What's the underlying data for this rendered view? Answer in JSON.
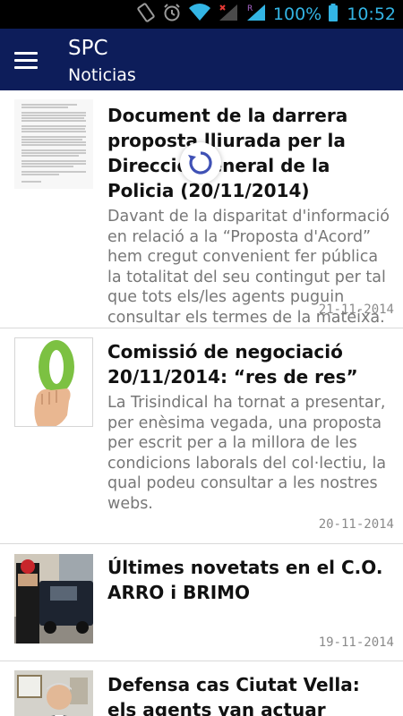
{
  "status_bar": {
    "battery_percent": "100%",
    "time": "10:52",
    "icons": [
      "screen-rotation-icon",
      "alarm-icon",
      "wifi-icon",
      "signal-icon",
      "signal-roaming-icon",
      "battery-icon"
    ],
    "accent_color": "#33b5e5"
  },
  "action_bar": {
    "title": "SPC",
    "subtitle": "Noticias",
    "background_color": "#0d1d5a",
    "menu_icon": "hamburger-menu-icon"
  },
  "news": [
    {
      "title": "Document de la darrera proposta lliurada per la Direcció General de la Policia (20/11/2014)",
      "summary": "Davant de la disparitat d'informació en relació a la “Proposta d'Acord” hem cregut convenient fer pública la totalitat del seu contingut per tal que tots els/les agents puguin consultar els termes de la mateixa.",
      "date": "21-11-2014",
      "thumbnail": "document-page-image"
    },
    {
      "title": "Comissió de negociació 20/11/2014: “res de res”",
      "summary": "La Trisindical ha tornat a presentar, per enèsima vegada, una proposta per escrit per a la millora de les condicions laborals del col·lectiu, la qual podeu consultar a les nostres webs.",
      "date": "20-11-2014",
      "thumbnail": "hand-holding-zero-image"
    },
    {
      "title": "Últimes novetats en el C.O. ARRO i BRIMO",
      "summary": "",
      "date": "19-11-2014",
      "thumbnail": "police-van-street-image"
    },
    {
      "title": "Defensa cas Ciutat Vella: els agents van actuar seguint els",
      "summary": "",
      "date": "",
      "thumbnail": "man-in-suit-image"
    }
  ],
  "loading_indicator": "refresh-spinner-icon"
}
